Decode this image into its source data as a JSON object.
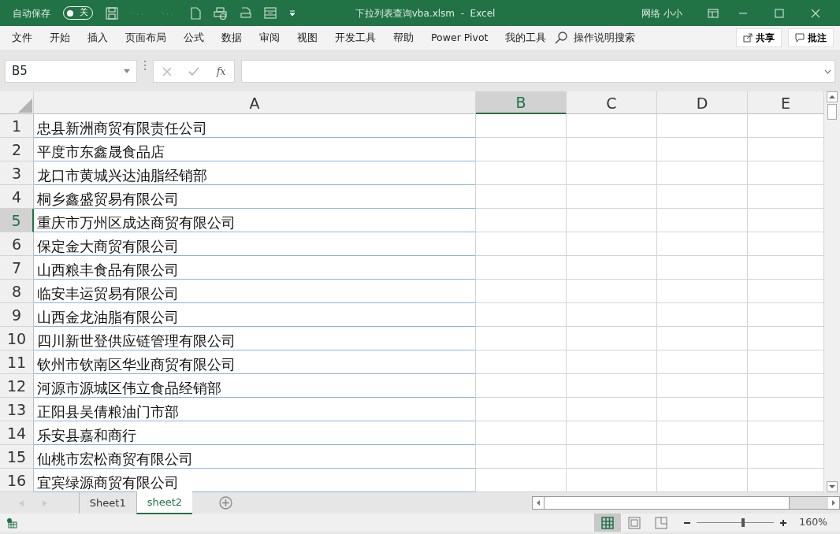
{
  "title_bar": {
    "autosave_label": "自动保存",
    "autosave": {
      "on": false,
      "label": "关"
    },
    "title": "下拉列表查询vba.xlsm  -  Excel",
    "user": "网络 小小"
  },
  "ribbon": {
    "tabs": [
      "文件",
      "开始",
      "插入",
      "页面布局",
      "公式",
      "数据",
      "审阅",
      "视图",
      "开发工具",
      "帮助",
      "Power Pivot",
      "我的工具"
    ],
    "search": "操作说明搜索",
    "share": "共享",
    "comments": "批注"
  },
  "formula_bar": {
    "name_box": "B5",
    "fx": "fx"
  },
  "columns": [
    {
      "label": "A",
      "selected": false
    },
    {
      "label": "B",
      "selected": true
    },
    {
      "label": "C",
      "selected": false
    },
    {
      "label": "D",
      "selected": false
    },
    {
      "label": "E",
      "selected": false
    }
  ],
  "rows": [
    {
      "number": "1",
      "selected": false,
      "a": "忠县新洲商贸有限责任公司"
    },
    {
      "number": "2",
      "selected": false,
      "a": "平度市东鑫晟食品店"
    },
    {
      "number": "3",
      "selected": false,
      "a": "龙口市黄城兴达油脂经销部"
    },
    {
      "number": "4",
      "selected": false,
      "a": "桐乡鑫盛贸易有限公司"
    },
    {
      "number": "5",
      "selected": true,
      "a": "重庆市万州区成达商贸有限公司"
    },
    {
      "number": "6",
      "selected": false,
      "a": "保定金大商贸有限公司"
    },
    {
      "number": "7",
      "selected": false,
      "a": "山西粮丰食品有限公司"
    },
    {
      "number": "8",
      "selected": false,
      "a": "临安丰运贸易有限公司"
    },
    {
      "number": "9",
      "selected": false,
      "a": "山西金龙油脂有限公司"
    },
    {
      "number": "10",
      "selected": false,
      "a": "四川新世登供应链管理有限公司"
    },
    {
      "number": "11",
      "selected": false,
      "a": "钦州市钦南区华业商贸有限公司"
    },
    {
      "number": "12",
      "selected": false,
      "a": "河源市源城区伟立食品经销部"
    },
    {
      "number": "13",
      "selected": false,
      "a": "正阳县吴倩粮油门市部"
    },
    {
      "number": "14",
      "selected": false,
      "a": "乐安县嘉和商行"
    },
    {
      "number": "15",
      "selected": false,
      "a": "仙桃市宏松商贸有限公司"
    },
    {
      "number": "16",
      "selected": false,
      "a": "宜宾绿源商贸有限公司"
    }
  ],
  "sheet_tabs": [
    {
      "label": "Sheet1",
      "selected": false
    },
    {
      "label": "sheet2",
      "selected": true
    }
  ],
  "status_bar": {
    "views": [
      {
        "kind": "normal",
        "selected": true
      },
      {
        "kind": "page-layout",
        "selected": false
      },
      {
        "kind": "page-break",
        "selected": false
      }
    ],
    "zoom": {
      "level": 0.6,
      "label": "160%"
    }
  }
}
